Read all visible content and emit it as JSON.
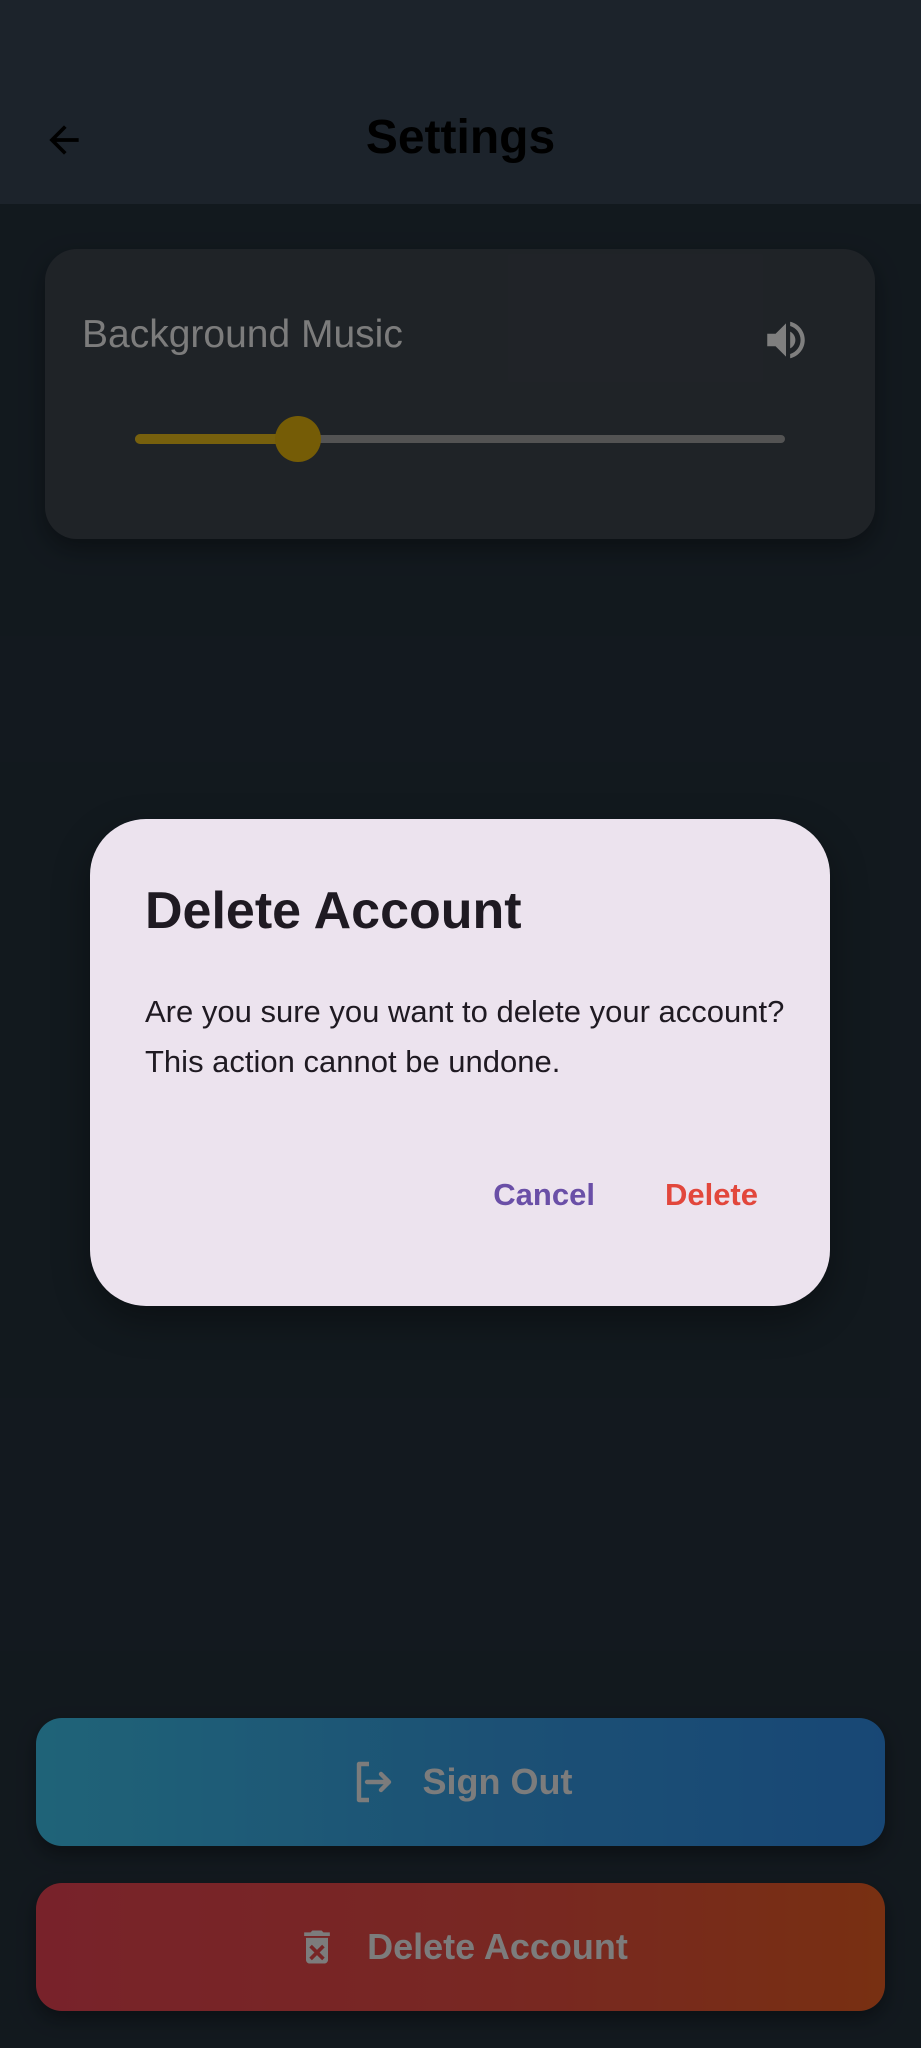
{
  "appbar": {
    "title": "Settings",
    "back_icon": "arrow-left-icon"
  },
  "music_card": {
    "label": "Background Music",
    "icon": "volume-up-icon",
    "slider_value": 0.25,
    "colors": {
      "active": "#c7a116",
      "thumb": "#c39a0a",
      "track": "#8a8a8a"
    }
  },
  "buttons": {
    "sign_out": {
      "label": "Sign Out",
      "icon": "logout-icon"
    },
    "delete_account": {
      "label": "Delete Account",
      "icon": "trash-icon"
    }
  },
  "dialog": {
    "title": "Delete Account",
    "message": "Are you sure you want to delete your account? This action cannot be undone.",
    "cancel_label": "Cancel",
    "delete_label": "Delete",
    "colors": {
      "cancel": "#6a4fa7",
      "delete": "#e2473c"
    }
  }
}
